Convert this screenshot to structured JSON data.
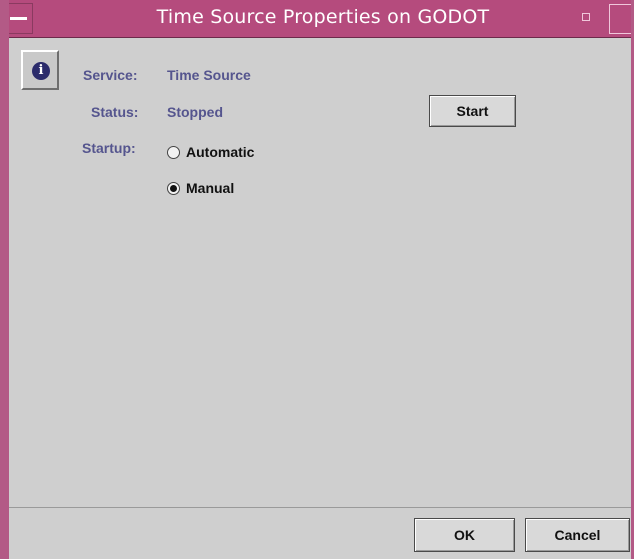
{
  "window": {
    "title": "Time Source Properties on GODOT"
  },
  "fields": {
    "service_label": "Service:",
    "service_value": "Time Source",
    "status_label": "Status:",
    "status_value": "Stopped",
    "startup_label": "Startup:"
  },
  "buttons": {
    "start": "Start",
    "ok": "OK",
    "cancel": "Cancel"
  },
  "startup_options": [
    {
      "label": "Automatic",
      "selected": false
    },
    {
      "label": "Manual",
      "selected": true
    }
  ],
  "icons": {
    "window_menu": "window-menu-icon",
    "minimize": "minimize-icon",
    "maximize": "maximize-icon",
    "info": "info-icon"
  },
  "colors": {
    "titlebar": "#b54b7d",
    "label_text": "#55558e",
    "background": "#cfcfcf"
  }
}
